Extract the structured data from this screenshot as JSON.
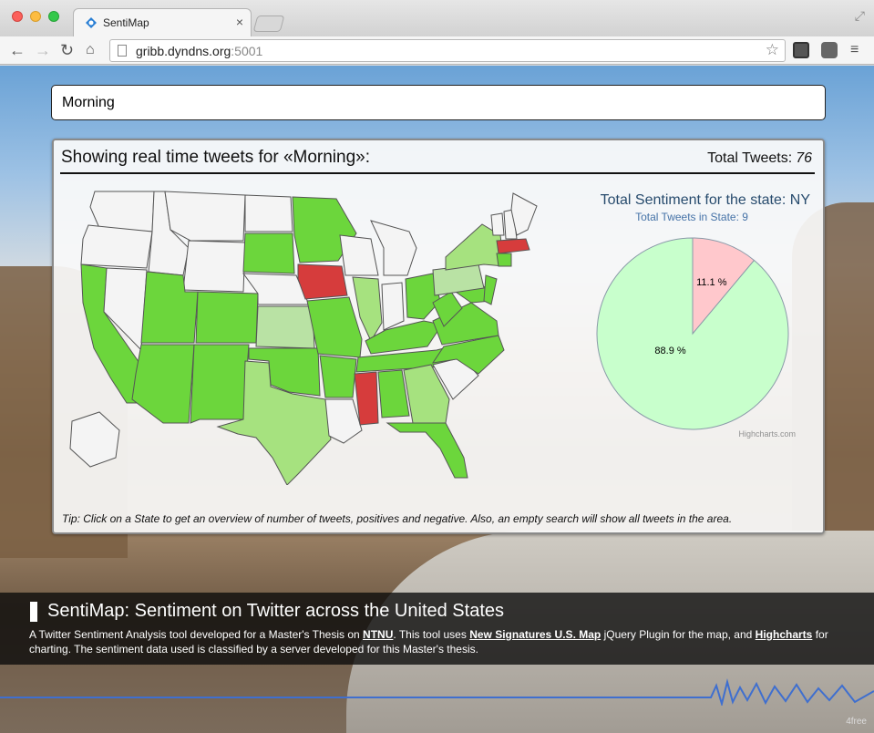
{
  "browser": {
    "tab_title": "SentiMap",
    "tab_close": "×",
    "url_host": "gribb.dyndns.org",
    "url_port": ":5001"
  },
  "search": {
    "value": "Morning"
  },
  "panel": {
    "title": "Showing real time tweets for «Morning»:",
    "total_label": "Total Tweets:",
    "total_value": "76",
    "tip": "Tip: Click on a State to get an overview of number of tweets, positives and negative. Also, an empty search will show all tweets in the area."
  },
  "chart_data": {
    "type": "pie",
    "title": "Total Sentiment for the state: NY",
    "subtitle": "Total Tweets in State: 9",
    "credit": "Highcharts.com",
    "series": [
      {
        "name": "",
        "values": [
          11.1,
          88.9
        ],
        "labels": [
          "11.1 %",
          "88.9 %"
        ],
        "colors": [
          "#ffc8cc",
          "#c8ffcc"
        ]
      }
    ]
  },
  "map": {
    "colors": {
      "none": "#f4f4f4",
      "positive": "#6cd63c",
      "light_positive": "#a6e27f",
      "pale_positive": "#b9e2a4",
      "negative": "#d63c3c"
    }
  },
  "banner": {
    "title": "SentiMap: Sentiment on Twitter across the United States",
    "text_1": "A Twitter Sentiment Analysis tool developed for a Master's Thesis on ",
    "link_1": "NTNU",
    "text_2": ". This tool uses ",
    "link_2": "New Signatures U.S. Map",
    "text_3": " jQuery Plugin for the map, and ",
    "link_3": "Highcharts",
    "text_4": " for charting. The sentiment data used is classified by a server developed for this Master's thesis."
  },
  "watermark": "4free"
}
